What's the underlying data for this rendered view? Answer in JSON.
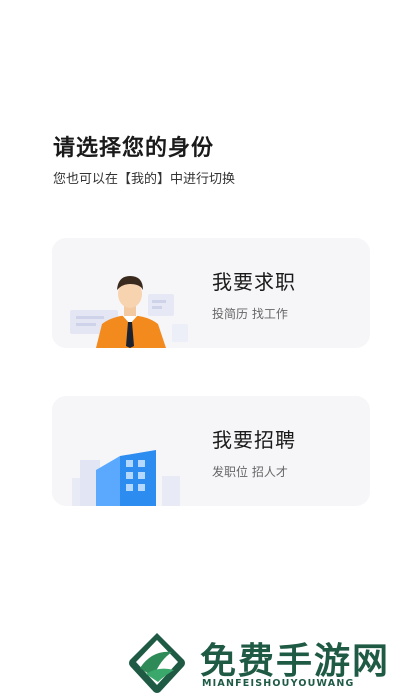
{
  "header": {
    "title": "请选择您的身份",
    "subtitle": "您也可以在【我的】中进行切换"
  },
  "options": [
    {
      "title": "我要求职",
      "subtitle": "投简历 找工作",
      "icon": "job-seeker-illustration"
    },
    {
      "title": "我要招聘",
      "subtitle": "发职位 招人才",
      "icon": "company-building-illustration"
    }
  ],
  "watermark": {
    "title": "免费手游网",
    "subtitle": "MIANFEISHOUYOUWANG",
    "icon": "leaf-logo-icon",
    "color": "#1f5a45"
  },
  "colors": {
    "card_bg": "#f6f6f9",
    "accent_orange": "#f28a1e",
    "accent_blue": "#2d8cf0"
  }
}
